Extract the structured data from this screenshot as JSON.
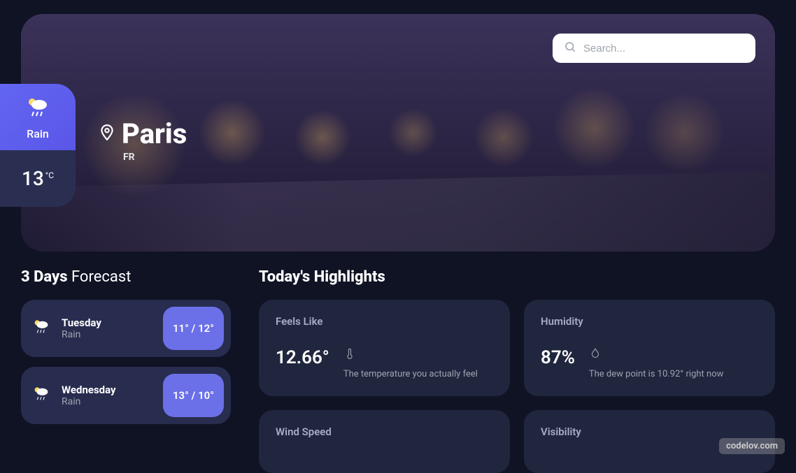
{
  "search": {
    "placeholder": "Search..."
  },
  "location": {
    "city": "Paris",
    "country": "FR"
  },
  "current": {
    "condition": "Rain",
    "temp": "13",
    "unit": "°C"
  },
  "forecast": {
    "title_bold": "3 Days",
    "title_rest": "Forecast",
    "items": [
      {
        "day": "Tuesday",
        "condition": "Rain",
        "temps": "11° / 12°"
      },
      {
        "day": "Wednesday",
        "condition": "Rain",
        "temps": "13° / 10°"
      }
    ]
  },
  "highlights": {
    "title": "Today's Highlights",
    "cards": [
      {
        "title": "Feels Like",
        "value": "12.66°",
        "desc": "The temperature you actually feel"
      },
      {
        "title": "Humidity",
        "value": "87%",
        "desc": "The dew point is 10.92° right now"
      },
      {
        "title": "Wind Speed",
        "value": "",
        "desc": ""
      },
      {
        "title": "Visibility",
        "value": "",
        "desc": ""
      }
    ]
  },
  "watermark": "codelov.com"
}
